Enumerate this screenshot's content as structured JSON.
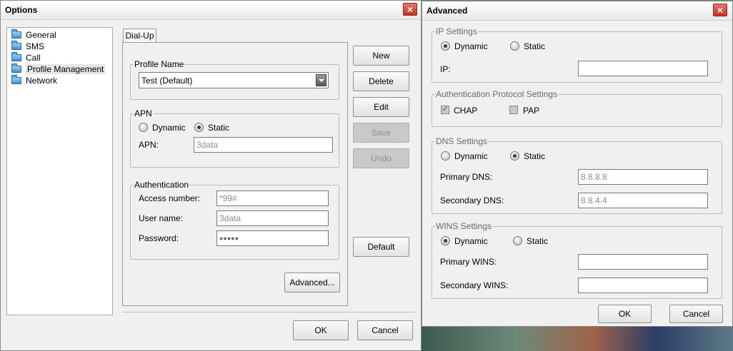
{
  "options": {
    "title": "Options",
    "close": "×",
    "tree": [
      "General",
      "SMS",
      "Call",
      "Profile Management",
      "Network"
    ],
    "tab": "Dial-Up",
    "profile_group": "Profile Name",
    "profile_value": "Test (Default)",
    "apn_group": "APN",
    "apn_dynamic": "Dynamic",
    "apn_static": "Static",
    "apn_label": "APN:",
    "apn_value": "3data",
    "auth_group": "Authentication",
    "access_label": "Access number:",
    "access_value": "*99#",
    "user_label": "User name:",
    "user_value": "3data",
    "password_label": "Password:",
    "password_value": "●●●●●",
    "buttons": {
      "new": "New",
      "delete": "Delete",
      "edit": "Edit",
      "save": "Save",
      "undo": "Undo",
      "default": "Default",
      "advanced": "Advanced...",
      "ok": "OK",
      "cancel": "Cancel"
    }
  },
  "advanced": {
    "title": "Advanced",
    "close": "×",
    "ip_group": "IP Settings",
    "ip_dynamic": "Dynamic",
    "ip_static": "Static",
    "ip_label": "IP:",
    "auth_group": "Authentication Protocol Settings",
    "chap": "CHAP",
    "chap_mark": "✓",
    "pap": "PAP",
    "dns_group": "DNS Settings",
    "dns_dynamic": "Dynamic",
    "dns_static": "Static",
    "primary_dns_label": "Primary DNS:",
    "primary_dns_value": "8.8.8.8",
    "secondary_dns_label": "Secondary DNS:",
    "secondary_dns_value": "8.8.4.4",
    "wins_group": "WINS Settings",
    "wins_dynamic": "Dynamic",
    "wins_static": "Static",
    "primary_wins_label": "Primary WINS:",
    "secondary_wins_label": "Secondary WINS:",
    "ok": "OK",
    "cancel": "Cancel"
  },
  "colors": {
    "close_red": "#c8341f",
    "window_bg": "#f0f0f0",
    "disabled_btn": "#c9c9c9"
  }
}
